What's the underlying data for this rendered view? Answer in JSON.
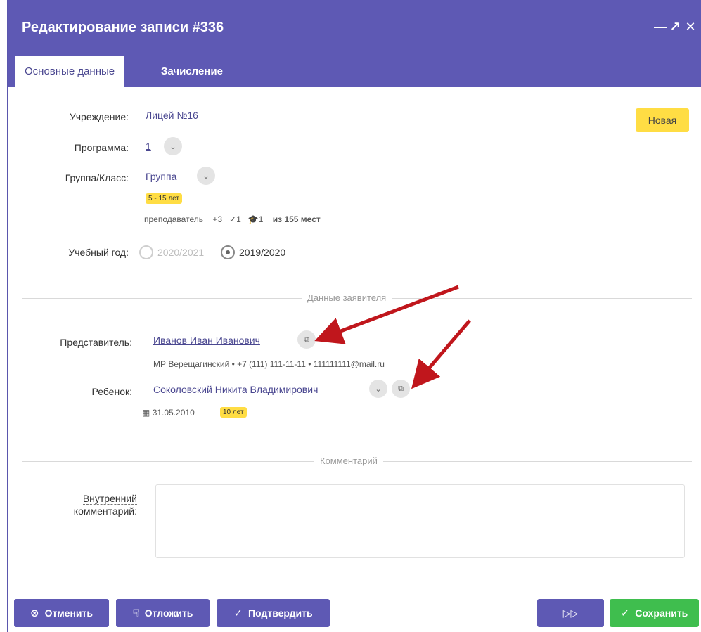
{
  "window": {
    "title": "Редактирование записи #336",
    "minimize_glyph": "—",
    "maximize_glyph": "↗",
    "close_glyph": "✕"
  },
  "tabs": [
    {
      "label": "Основные данные",
      "active": true
    },
    {
      "label": "Зачисление",
      "active": false
    }
  ],
  "status": {
    "label": "Новая",
    "color": "#ffdd44"
  },
  "form": {
    "institution": {
      "label": "Учреждение:",
      "value": "Лицей №16"
    },
    "program": {
      "label": "Программа:",
      "value": "1"
    },
    "group": {
      "label": "Группа/Класс:",
      "value": "Группа",
      "age_badge": "5 - 15 лет",
      "teacher": "преподаватель",
      "plus_count": "+3",
      "check_count": "✓1",
      "grad_count": "1",
      "seats": "из 155 мест"
    },
    "school_year": {
      "label": "Учебный год:",
      "options": [
        {
          "label": "2020/2021",
          "checked": false
        },
        {
          "label": "2019/2020",
          "checked": true
        }
      ]
    }
  },
  "applicant_section": {
    "title": "Данные заявителя",
    "representative": {
      "label": "Представитель:",
      "name": "Иванов Иван Иванович",
      "details": "МР Верещагинский • +7 (111) 111-11-11 • 111111111@mail.ru"
    },
    "child": {
      "label": "Ребенок:",
      "name": "Соколовский Никита Владимирович",
      "birth_date": "31.05.2010",
      "age_badge": "10 лет"
    }
  },
  "comment_section": {
    "title": "Комментарий",
    "internal_label_line1": "Внутренний",
    "internal_label_line2": "комментарий:",
    "internal_value": ""
  },
  "buttons": {
    "cancel": "Отменить",
    "postpone": "Отложить",
    "confirm": "Подтвердить",
    "next_glyph": "▷▷",
    "save": "Сохранить"
  },
  "colors": {
    "header": "#5e59b4",
    "link": "#4a4790",
    "save": "#3fbe4e",
    "badge": "#ffdd44",
    "annotation_arrow": "#c0161c"
  }
}
